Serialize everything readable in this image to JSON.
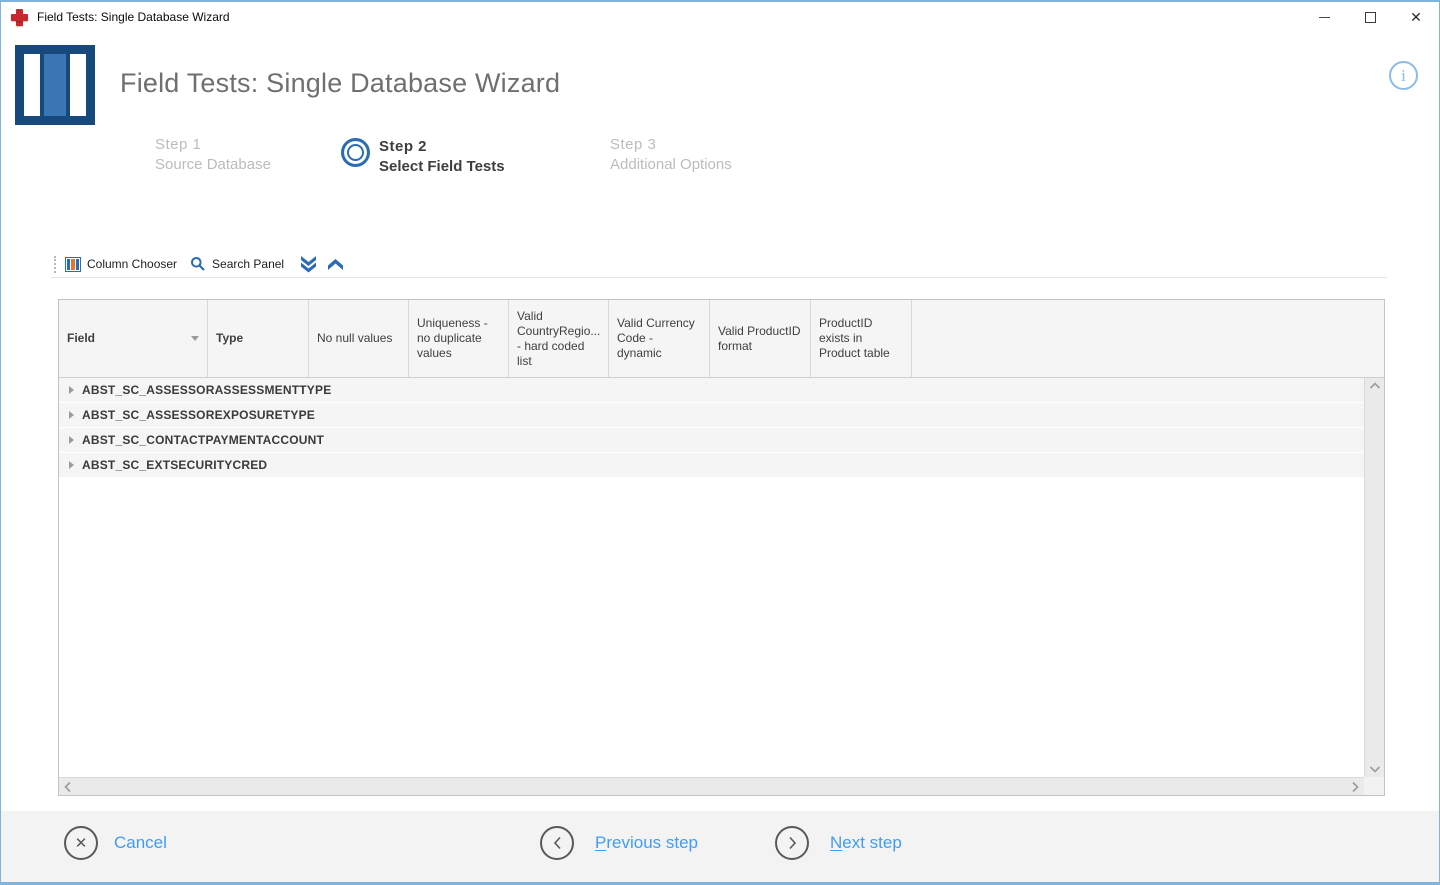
{
  "window": {
    "title": "Field Tests: Single Database Wizard",
    "icons": {
      "app": "red-cross",
      "minimize": "minimize-dash",
      "maximize": "maximize-square",
      "close": "close-x"
    }
  },
  "header": {
    "title": "Field Tests: Single Database Wizard",
    "info_glyph": "i",
    "logo_icon": "blue-database-columns"
  },
  "steps": {
    "step1": {
      "num": "Step 1",
      "label": "Source Database",
      "state": "inactive"
    },
    "step2": {
      "num": "Step 2",
      "label": "Select Field Tests",
      "state": "active",
      "icon": "double-ring"
    },
    "step3": {
      "num": "Step 3",
      "label": "Additional Options",
      "state": "inactive"
    }
  },
  "toolbar": {
    "column_chooser_label": "Column Chooser",
    "search_panel_label": "Search Panel",
    "icons": {
      "column_chooser": "grid-columns",
      "search": "magnifier",
      "collapse": "double-chevron-down",
      "expand": "chevron-up"
    }
  },
  "grid": {
    "columns": [
      {
        "label": "Field",
        "sort": "desc"
      },
      {
        "label": "Type"
      },
      {
        "label": "No null values"
      },
      {
        "label": "Uniqueness - no duplicate values"
      },
      {
        "label": "Valid CountryRegio... - hard coded list"
      },
      {
        "label": "Valid Currency Code - dynamic"
      },
      {
        "label": "Valid ProductID format"
      },
      {
        "label": "ProductID exists in Product table"
      }
    ],
    "rows": [
      "ABST_SC_ASSESSORASSESSMENTTYPE",
      "ABST_SC_ASSESSOREXPOSURETYPE",
      "ABST_SC_CONTACTPAYMENTACCOUNT",
      "ABST_SC_EXTSECURITYCRED"
    ]
  },
  "footer": {
    "cancel": {
      "label": "Cancel",
      "icon": "x-circle"
    },
    "previous": {
      "mnemonic": "P",
      "rest": "revious step",
      "icon": "chevron-left-circle"
    },
    "next": {
      "mnemonic": "N",
      "rest": "ext step",
      "icon": "chevron-right-circle"
    }
  },
  "colors": {
    "window_border": "#7eb4dd",
    "cross_red": "#c8272d",
    "logo_navy": "#17497c",
    "logo_mid_blue": "#3c77b5",
    "accent_blue": "#2b6cb5",
    "link_blue": "#3f9df5",
    "chooser_orange": "#e87722",
    "grid_header_bg": "#f5f5f5",
    "group_row_bg": "#f5f5f5",
    "footer_bg": "#f3f3f3"
  }
}
